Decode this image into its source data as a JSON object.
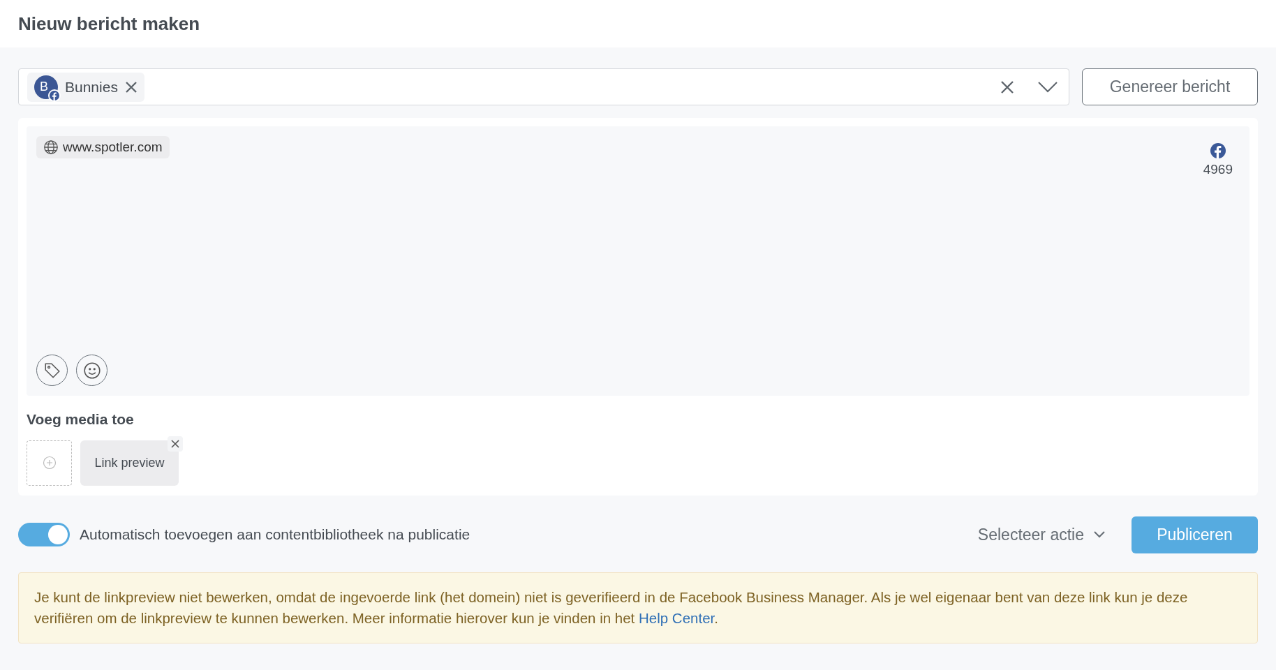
{
  "title": "Nieuw bericht maken",
  "selector": {
    "chips": [
      {
        "initial": "B",
        "label": "Bunnies"
      }
    ]
  },
  "generate_button": "Genereer bericht",
  "editor": {
    "link_chip": "www.spotler.com",
    "counters": [
      {
        "count": "4969"
      }
    ]
  },
  "media": {
    "heading": "Voeg media toe",
    "items": [
      {
        "label": "Link preview"
      }
    ]
  },
  "auto_add": {
    "on": true,
    "label": "Automatisch toevoegen aan contentbibliotheek na publicatie"
  },
  "action_select": "Selecteer actie",
  "publish_button": "Publiceren",
  "notice": {
    "text": "Je kunt de linkpreview niet bewerken, omdat de ingevoerde link (het domein) niet is geverifieerd in de Facebook Business Manager. Als je wel eigenaar bent van deze link kun je deze verifiëren om de linkpreview te kunnen bewerken. Meer informatie hierover kun je vinden in het ",
    "link": "Help Center",
    "after": "."
  }
}
